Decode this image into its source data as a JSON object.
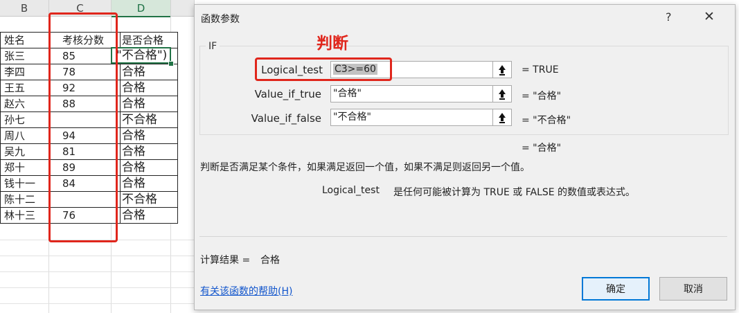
{
  "sheet": {
    "columns": [
      "B",
      "C",
      "D"
    ],
    "headers": [
      "姓名",
      "考核分数",
      "是否合格"
    ],
    "rows": [
      {
        "name": "张三",
        "score": "85",
        "pass": ""
      },
      {
        "name": "李四",
        "score": "78",
        "pass": "合格"
      },
      {
        "name": "王五",
        "score": "92",
        "pass": "合格"
      },
      {
        "name": "赵六",
        "score": "88",
        "pass": "合格"
      },
      {
        "name": "孙七",
        "score": "",
        "pass": "不合格"
      },
      {
        "name": "周八",
        "score": "94",
        "pass": "合格"
      },
      {
        "name": "吴九",
        "score": "81",
        "pass": "合格"
      },
      {
        "name": "郑十",
        "score": "89",
        "pass": "合格"
      },
      {
        "name": "钱十一",
        "score": "84",
        "pass": "合格"
      },
      {
        "name": "陈十二",
        "score": "",
        "pass": "不合格"
      },
      {
        "name": "林十三",
        "score": "76",
        "pass": "合格"
      }
    ],
    "active_cell_text": "\"不合格\")"
  },
  "dialog": {
    "title": "函数参数",
    "help_glyph": "?",
    "close_glyph": "✕",
    "function_name": "IF",
    "annotation": "判断",
    "args": [
      {
        "label": "Logical_test",
        "value": "C3>=60",
        "result": "=   TRUE"
      },
      {
        "label": "Value_if_true",
        "value": "\"合格\"",
        "result": "=   \"合格\""
      },
      {
        "label": "Value_if_false",
        "value": "\"不合格\"",
        "result": "=   \"不合格\""
      }
    ],
    "overall_result": "=   \"合格\"",
    "description": "判断是否满足某个条件，如果满足返回一个值，如果不满足则返回另一个值。",
    "arg_desc_name": "Logical_test",
    "arg_desc": "是任何可能被计算为 TRUE 或 FALSE 的数值或表达式。",
    "calc_label": "计算结果 =",
    "calc_value": "合格",
    "help_link": "有关该函数的帮助(H)",
    "ok_label": "确定",
    "cancel_label": "取消"
  },
  "colors": {
    "accent_red": "#e0261c",
    "excel_green": "#217346",
    "link_blue": "#1155cc"
  }
}
